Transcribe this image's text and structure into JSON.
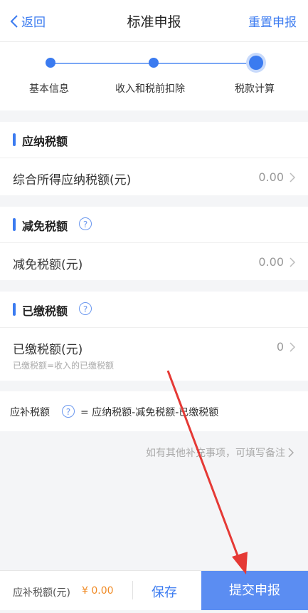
{
  "header": {
    "back_label": "返回",
    "title": "标准申报",
    "reset_label": "重置申报"
  },
  "steps": [
    {
      "label": "基本信息",
      "state": "done"
    },
    {
      "label": "收入和税前扣除",
      "state": "done"
    },
    {
      "label": "税款计算",
      "state": "current"
    }
  ],
  "sections": {
    "payable": {
      "title": "应纳税额",
      "row_label": "综合所得应纳税额(元)",
      "row_value": "0.00"
    },
    "reduction": {
      "title": "减免税额",
      "row_label": "减免税额(元)",
      "row_value": "0.00"
    },
    "paid": {
      "title": "已缴税额",
      "row_label": "已缴税额(元)",
      "row_value": "0",
      "row_sub": "已缴税额=收入的已缴税额"
    }
  },
  "formula": {
    "label": "应补税额",
    "expression": "= 应纳税额-减免税额-已缴税额"
  },
  "remark": "如有其他补充事项，可填写备注",
  "bottom_bar": {
    "amount_label": "应补税额(元)",
    "amount_value": "¥ 0.00",
    "save_label": "保存",
    "submit_label": "提交申报"
  },
  "colors": {
    "accent": "#3b7bf0",
    "amount": "#f08a24",
    "submit_bg": "#5b8df2",
    "annotation_arrow": "#e53935"
  },
  "icons": {
    "help": "question-circle-icon",
    "chevron": "chevron-right-icon",
    "back": "chevron-left-icon"
  }
}
